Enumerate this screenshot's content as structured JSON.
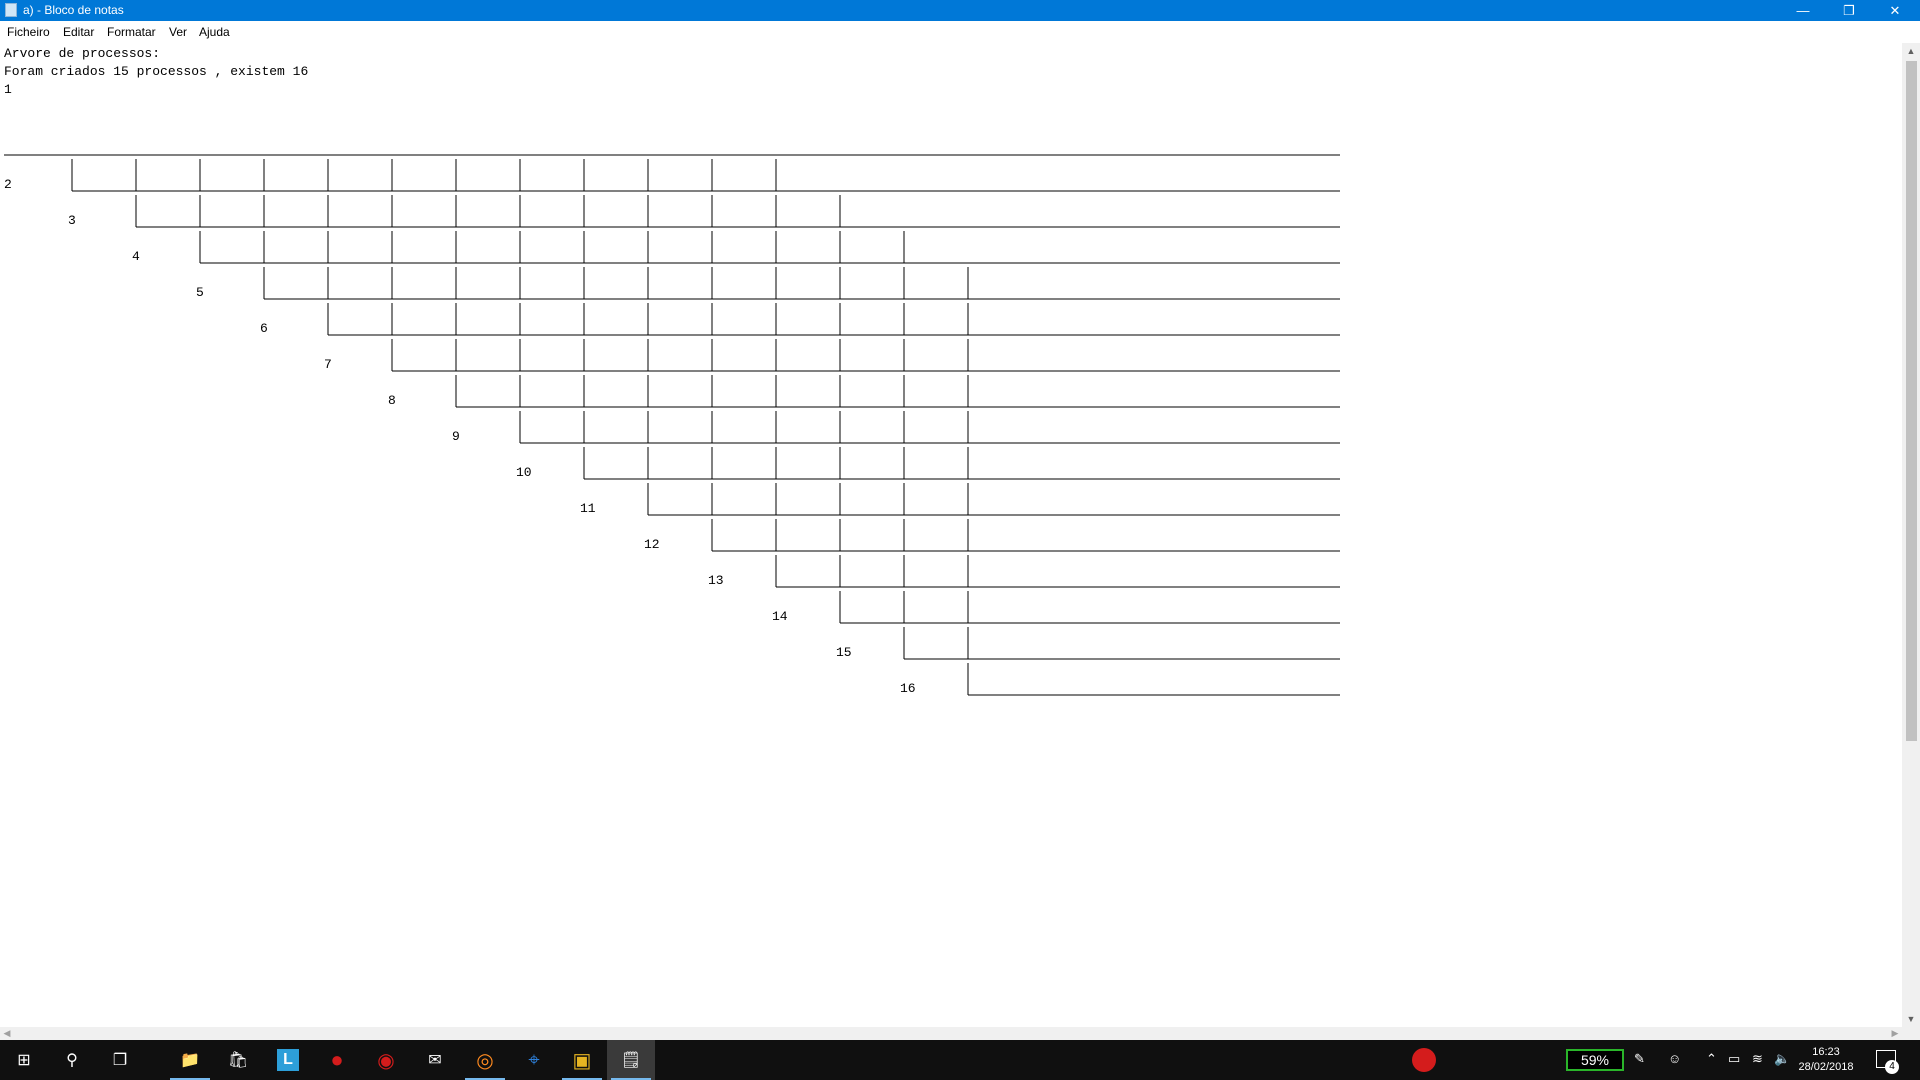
{
  "window": {
    "title": "a) - Bloco de notas",
    "controls": {
      "minimize": "—",
      "restore": "❐",
      "close": "✕"
    }
  },
  "menu": [
    {
      "label": "Ficheiro"
    },
    {
      "label": "Editar"
    },
    {
      "label": "Formatar"
    },
    {
      "label": "Ver"
    },
    {
      "label": "Ajuda"
    }
  ],
  "document": {
    "lines": [
      "Arvore de processos:",
      "Foram criados 15 processos , existem 16",
      "1"
    ],
    "tree_labels": [
      "2",
      "3",
      "4",
      "5",
      "6",
      "7",
      "8",
      "9",
      "10",
      "11",
      "12",
      "13",
      "14",
      "15",
      "16"
    ]
  },
  "taskbar": {
    "icons": [
      {
        "name": "start-icon",
        "glyph": "⊞"
      },
      {
        "name": "search-icon",
        "glyph": "⚲"
      },
      {
        "name": "task-view-icon",
        "glyph": "❐"
      },
      {
        "name": "file-explorer-icon",
        "glyph": "📁"
      },
      {
        "name": "store-icon",
        "glyph": "🛍"
      },
      {
        "name": "l-app-icon",
        "glyph": "L"
      },
      {
        "name": "red-app-icon",
        "glyph": "●"
      },
      {
        "name": "red-app2-icon",
        "glyph": "◉"
      },
      {
        "name": "mail-icon",
        "glyph": "✉"
      },
      {
        "name": "firefox-icon",
        "glyph": "◎"
      },
      {
        "name": "maps-icon",
        "glyph": "⌖"
      },
      {
        "name": "yellow-app-icon",
        "glyph": "▣"
      },
      {
        "name": "notepad-icon",
        "glyph": "🗒"
      }
    ],
    "battery": "59%",
    "time": "16:23",
    "date": "28/02/2018",
    "notification_count": "4",
    "accent": "#76b9ed"
  }
}
